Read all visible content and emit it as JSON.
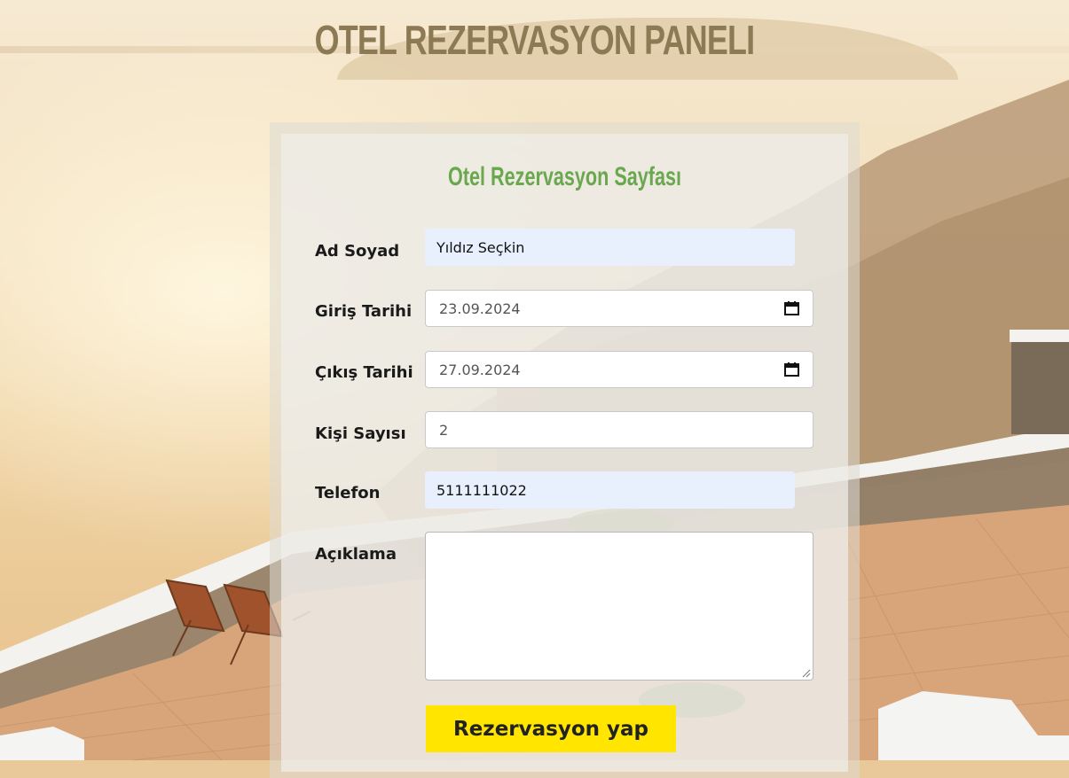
{
  "header": {
    "title": "OTEL REZERVASYON PANELI"
  },
  "form": {
    "title": "Otel Rezervasyon Sayfası",
    "fields": {
      "name": {
        "label": "Ad Soyad",
        "value": "Yıldız Seçkin"
      },
      "checkin": {
        "label": "Giriş Tarihi",
        "value": "23.09.2024",
        "icon": "calendar-icon"
      },
      "checkout": {
        "label": "Çıkış Tarihi",
        "value": "27.09.2024",
        "icon": "calendar-icon"
      },
      "guests": {
        "label": "Kişi Sayısı",
        "value": "2"
      },
      "phone": {
        "label": "Telefon",
        "value": "5111111022"
      },
      "note": {
        "label": "Açıklama",
        "value": ""
      }
    },
    "submit_label": "Rezervasyon yap"
  },
  "colors": {
    "title": "#8c7a55",
    "form_title": "#6aa84f",
    "button": "#ffe500",
    "autofill": "#e8f0fe"
  }
}
